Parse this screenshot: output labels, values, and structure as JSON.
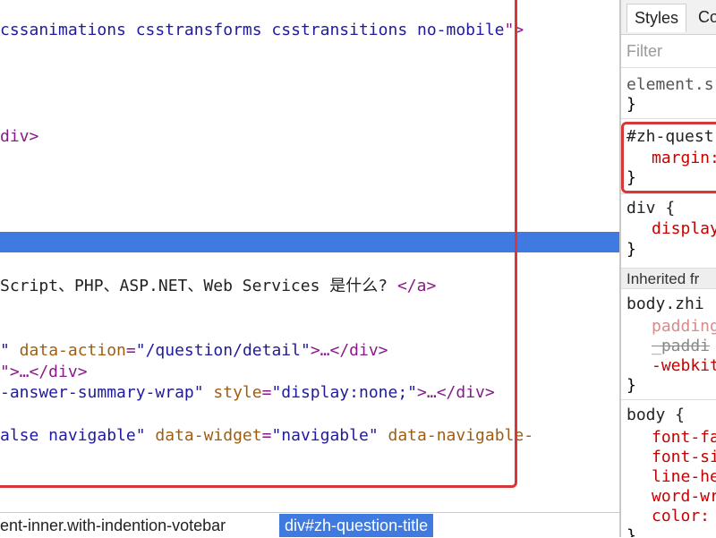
{
  "elements_panel": {
    "lines": [
      {
        "type": "text",
        "parts": [
          [
            "av",
            "cssanimations csstransforms csstransitions no-mobile"
          ],
          [
            "t",
            "\">"
          ]
        ]
      },
      {
        "type": "text",
        "parts": [
          [
            "t",
            "div>"
          ]
        ]
      },
      {
        "type": "text",
        "parts": [
          [
            "tx",
            "Script、PHP、ASP.NET、Web Services 是什么? "
          ],
          [
            "t",
            "</a>"
          ]
        ]
      },
      {
        "type": "text",
        "parts": [
          [
            "av",
            "\""
          ],
          [
            "an",
            " data-action"
          ],
          [
            "t",
            "="
          ],
          [
            "av",
            "\"/question/detail\""
          ],
          [
            "t",
            ">…</div>"
          ]
        ]
      },
      {
        "type": "text",
        "parts": [
          [
            "t",
            "\">…</div>"
          ]
        ]
      },
      {
        "type": "text",
        "parts": [
          [
            "av",
            "-answer-summary-wrap\""
          ],
          [
            "an",
            " style"
          ],
          [
            "t",
            "="
          ],
          [
            "av",
            "\"display:none;\""
          ],
          [
            "t",
            ">…</div>"
          ]
        ]
      },
      {
        "type": "text",
        "parts": [
          [
            "av",
            "alse navigable\""
          ],
          [
            "an",
            " data-widget"
          ],
          [
            "t",
            "="
          ],
          [
            "av",
            "\"navigable\""
          ],
          [
            "an",
            " data-navigable-"
          ]
        ]
      }
    ]
  },
  "breadcrumbs": {
    "items": [
      {
        "label": "ent-inner.with-indention-votebar",
        "active": false
      },
      {
        "label": "div#zh-question-title",
        "active": true
      }
    ]
  },
  "styles_pane": {
    "tabs": [
      {
        "label": "Styles",
        "active": true
      },
      {
        "label": "Co",
        "active": false
      }
    ],
    "filter_placeholder": "Filter",
    "rule_element_selector": "element.s",
    "rule_element_close": "}",
    "rule_zh_selector": "#zh-quest",
    "rule_zh_prop": "margin:",
    "rule_zh_close": "}",
    "rule_div_selector": "div {",
    "rule_div_prop": "display",
    "rule_div_close": "}",
    "inherited_label": "Inherited fr",
    "rule_bodyzhi_selector": "body.zhi",
    "rule_bodyzhi_props": [
      {
        "text": "padding",
        "style": "faded"
      },
      {
        "text": "_paddi",
        "style": "strike"
      },
      {
        "text": "-webkit",
        "style": "normal"
      }
    ],
    "rule_bodyzhi_close": "}",
    "rule_body_selector": "body {",
    "rule_body_props": [
      "font-fa",
      "font-si",
      "line-he",
      "word-wr",
      "color:"
    ],
    "rule_body_close": "}"
  },
  "colors": {
    "selection": "#3f7ae0",
    "highlight_box": "#d8373a",
    "tag": "#891a8a",
    "attr_name": "#9d5e14",
    "attr_value": "#1f1a9e",
    "css_property": "#c80000"
  }
}
